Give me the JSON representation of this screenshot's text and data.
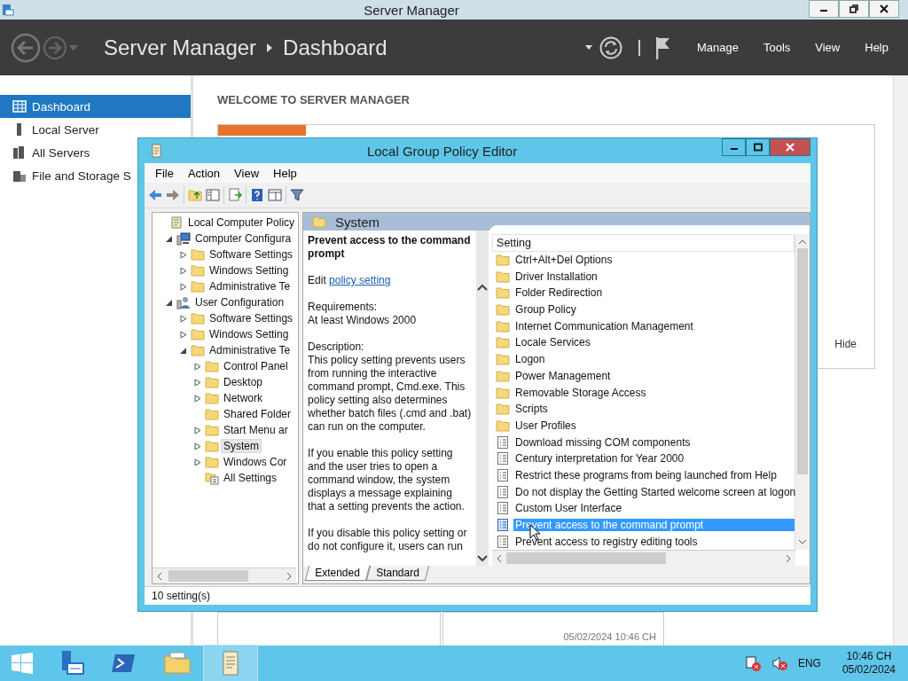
{
  "server_manager": {
    "title": "Server Manager",
    "breadcrumb": [
      "Server Manager",
      "Dashboard"
    ],
    "menu": [
      "Manage",
      "Tools",
      "View",
      "Help"
    ],
    "nav": [
      {
        "label": "Dashboard",
        "kind": "dashboard",
        "selected": true
      },
      {
        "label": "Local Server",
        "kind": "server",
        "selected": false
      },
      {
        "label": "All Servers",
        "kind": "servers",
        "selected": false
      },
      {
        "label": "File and Storage S",
        "kind": "storage",
        "selected": false
      }
    ],
    "welcome_heading": "WELCOME TO SERVER MANAGER",
    "hide_link": "Hide",
    "tile_timestamp": "05/02/2024 10:46 CH"
  },
  "gpo_window": {
    "title": "Local Group Policy Editor",
    "menu": [
      "File",
      "Action",
      "View",
      "Help"
    ],
    "tree": [
      {
        "label": "Local Computer Policy",
        "kind": "root",
        "selected": false,
        "children": [
          {
            "label": "Computer Configura",
            "kind": "computer",
            "expanded": true,
            "selected": false,
            "children": [
              {
                "label": "Software Settings",
                "kind": "folder",
                "expanded": false,
                "selected": false
              },
              {
                "label": "Windows Setting",
                "kind": "folder",
                "expanded": false,
                "selected": false
              },
              {
                "label": "Administrative Te",
                "kind": "folder",
                "expanded": false,
                "selected": false
              }
            ]
          },
          {
            "label": "User Configuration",
            "kind": "user",
            "expanded": true,
            "selected": false,
            "children": [
              {
                "label": "Software Settings",
                "kind": "folder",
                "expanded": false,
                "selected": false
              },
              {
                "label": "Windows Setting",
                "kind": "folder",
                "expanded": false,
                "selected": false
              },
              {
                "label": "Administrative Te",
                "kind": "folder",
                "expanded": true,
                "selected": false,
                "children": [
                  {
                    "label": "Control Panel",
                    "kind": "folder",
                    "expanded": false,
                    "selected": false
                  },
                  {
                    "label": "Desktop",
                    "kind": "folder",
                    "expanded": false,
                    "selected": false
                  },
                  {
                    "label": "Network",
                    "kind": "folder",
                    "expanded": false,
                    "selected": false
                  },
                  {
                    "label": "Shared Folder",
                    "kind": "folder",
                    "selected": false
                  },
                  {
                    "label": "Start Menu ar",
                    "kind": "folder",
                    "expanded": false,
                    "selected": false
                  },
                  {
                    "label": "System",
                    "kind": "folder",
                    "expanded": false,
                    "selected": true
                  },
                  {
                    "label": "Windows Cor",
                    "kind": "folder",
                    "expanded": false,
                    "selected": false
                  },
                  {
                    "label": "All Settings",
                    "kind": "settings",
                    "selected": false
                  }
                ]
              }
            ]
          }
        ]
      }
    ],
    "detail": {
      "heading": "System",
      "policy_title": "Prevent access to the command prompt",
      "edit_prefix": "Edit",
      "edit_link": "policy setting",
      "requirements_label": "Requirements:",
      "requirements": "At least Windows 2000",
      "description_label": "Description:",
      "paragraphs": [
        "This policy setting prevents users from running the interactive command prompt, Cmd.exe.  This policy setting also determines whether batch files (.cmd and .bat) can run on the computer.",
        "If you enable this policy setting and the user tries to open a command window, the system displays a message explaining that a setting prevents the action.",
        "If you disable this policy setting or do not configure it, users can run"
      ]
    },
    "settings": {
      "column": "Setting",
      "rows": [
        {
          "label": "Ctrl+Alt+Del Options",
          "kind": "folder",
          "selected": false
        },
        {
          "label": "Driver Installation",
          "kind": "folder",
          "selected": false
        },
        {
          "label": "Folder Redirection",
          "kind": "folder",
          "selected": false
        },
        {
          "label": "Group Policy",
          "kind": "folder",
          "selected": false
        },
        {
          "label": "Internet Communication Management",
          "kind": "folder",
          "selected": false
        },
        {
          "label": "Locale Services",
          "kind": "folder",
          "selected": false
        },
        {
          "label": "Logon",
          "kind": "folder",
          "selected": false
        },
        {
          "label": "Power Management",
          "kind": "folder",
          "selected": false
        },
        {
          "label": "Removable Storage Access",
          "kind": "folder",
          "selected": false
        },
        {
          "label": "Scripts",
          "kind": "folder",
          "selected": false
        },
        {
          "label": "User Profiles",
          "kind": "folder",
          "selected": false
        },
        {
          "label": "Download missing COM components",
          "kind": "policy",
          "selected": false
        },
        {
          "label": "Century interpretation for Year 2000",
          "kind": "policy",
          "selected": false
        },
        {
          "label": "Restrict these programs from being launched from Help",
          "kind": "policy",
          "selected": false
        },
        {
          "label": "Do not display the Getting Started welcome screen at logon",
          "kind": "policy",
          "selected": false
        },
        {
          "label": "Custom User Interface",
          "kind": "policy",
          "selected": false
        },
        {
          "label": "Prevent access to the command prompt",
          "kind": "policy",
          "selected": true
        },
        {
          "label": "Prevent access to registry editing tools",
          "kind": "policy",
          "selected": false
        }
      ]
    },
    "view_tabs": [
      {
        "label": "Extended",
        "selected": true
      },
      {
        "label": "Standard",
        "selected": false
      }
    ],
    "status": "10 setting(s)"
  },
  "taskbar": {
    "apps": [
      {
        "kind": "server-manager",
        "selected": false
      },
      {
        "kind": "powershell",
        "selected": false
      },
      {
        "kind": "explorer",
        "selected": false
      },
      {
        "kind": "policy-editor",
        "selected": true
      }
    ],
    "language": "ENG",
    "time": "10:46 CH",
    "date": "05/02/2024"
  }
}
